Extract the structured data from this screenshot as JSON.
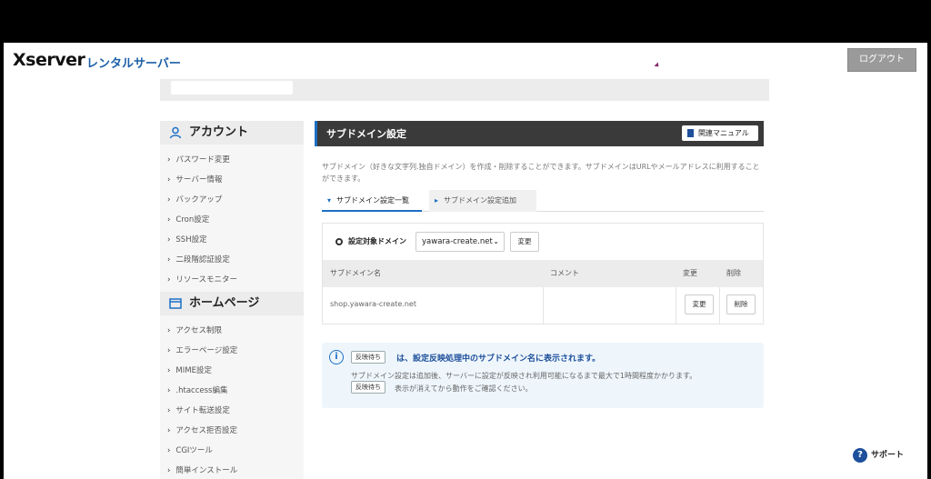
{
  "header": {
    "logo": "Xserver",
    "logo_sub": "レンタルサーバー",
    "logout_label": "ログアウト"
  },
  "sidebar": {
    "account_heading": "アカウント",
    "account_items": [
      "パスワード変更",
      "サーバー情報",
      "バックアップ",
      "Cron設定",
      "SSH設定",
      "二段階認証設定",
      "リソースモニター"
    ],
    "homepage_heading": "ホームページ",
    "homepage_items": [
      "アクセス制限",
      "エラーページ設定",
      "MIME設定",
      ".htaccess編集",
      "サイト転送設定",
      "アクセス拒否設定",
      "CGIツール",
      "簡単インストール"
    ]
  },
  "main": {
    "title": "サブドメイン設定",
    "manual_label": "関連マニュアル",
    "description": "サブドメイン（好きな文字列.独自ドメイン）を作成・削除することができます。サブドメインはURLやメールアドレスに利用することができます。",
    "tabs": [
      "サブドメイン設定一覧",
      "サブドメイン設定追加"
    ],
    "domain_label": "設定対象ドメイン",
    "domain_value": "yawara-create.net",
    "change_label": "変更",
    "table": {
      "headers": [
        "サブドメイン名",
        "コメント",
        "変更",
        "削除"
      ],
      "rows": [
        {
          "subdomain": "shop.yawara-create.net",
          "comment": "",
          "edit": "変更",
          "delete": "削除"
        }
      ]
    },
    "notice": {
      "pill": "反映待ち",
      "main": "は、設定反映処理中のサブドメイン名に表示されます。",
      "line2": "サブドメイン設定は追加後、サーバーに設定が反映され利用可能になるまで最大で1時間程度かかります。",
      "line3": "表示が消えてから動作をご確認ください。"
    }
  },
  "support_label": "サポート"
}
